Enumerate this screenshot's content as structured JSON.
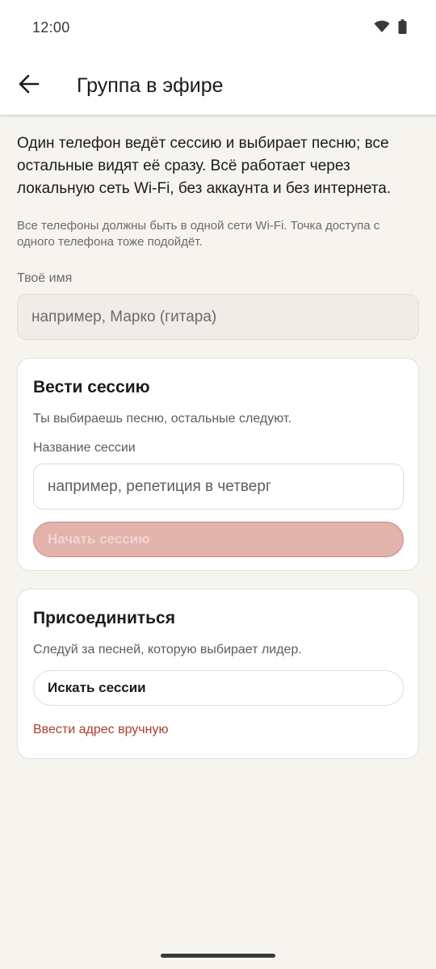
{
  "status_bar": {
    "time": "12:00",
    "icons": [
      "wifi-icon",
      "battery-icon"
    ]
  },
  "app_bar": {
    "back_icon": "arrow-left-icon",
    "title": "Группа в эфире"
  },
  "intro": {
    "text": "Один телефон ведёт сессию и выбирает песню; все остальные видят её сразу. Всё работает через локальную сеть Wi-Fi, без аккаунта и без интернета.",
    "hint": "Все телефоны должны быть в одной сети Wi-Fi. Точка доступа с одного телефона тоже подойдёт."
  },
  "name_field": {
    "label": "Твоё имя",
    "value": "",
    "placeholder": "например, Марко (гитара)"
  },
  "lead_card": {
    "title": "Вести сессию",
    "subtitle": "Ты выбираешь песню, остальные следуют.",
    "session_label": "Название сессии",
    "session_value": "",
    "session_placeholder": "например, репетиция в четверг",
    "start_button": "Начать сессию",
    "start_enabled": false
  },
  "join_card": {
    "title": "Присоединиться",
    "subtitle": "Следуй за песней, которую выбирает лидер.",
    "search_button": "Искать сессии",
    "manual_link": "Ввести адрес вручную"
  },
  "colors": {
    "background": "#f6f4ef",
    "accent": "#a9402a",
    "disabled_button": "#e2b3ab"
  }
}
